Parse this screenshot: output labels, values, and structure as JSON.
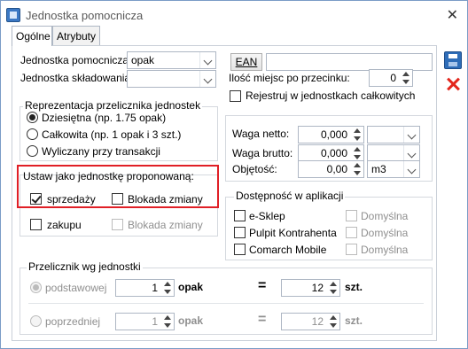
{
  "window": {
    "title": "Jednostka pomocnicza",
    "icon": "app-window-icon"
  },
  "tabs": [
    {
      "label": "Ogólne",
      "active": true
    },
    {
      "label": "Atrybuty",
      "active": false
    }
  ],
  "fields": {
    "aux_unit_label": "Jednostka pomocnicza:",
    "aux_unit_value": "opak",
    "warehouse_unit_label": "Jednostka składowania:",
    "warehouse_unit_value": "",
    "ean_button": "EAN",
    "ean_value": "",
    "decimals_label": "Ilość miejsc po przecinku:",
    "decimals_value": "0",
    "register_whole_label": "Rejestruj w jednostkach całkowitych"
  },
  "conversion_repr": {
    "title": "Reprezentacja przelicznika jednostek",
    "options": [
      {
        "label": "Dziesiętna (np. 1.75 opak)",
        "selected": true
      },
      {
        "label": "Całkowita (np. 1 opak i 3 szt.)",
        "selected": false
      },
      {
        "label": "Wyliczany przy transakcji",
        "selected": false
      }
    ]
  },
  "measures": {
    "net_weight_label": "Waga netto:",
    "net_weight_value": "0,000",
    "net_weight_unit": "",
    "gross_weight_label": "Waga brutto:",
    "gross_weight_value": "0,000",
    "gross_weight_unit": "",
    "volume_label": "Objętość:",
    "volume_value": "0,00",
    "volume_unit": "m3"
  },
  "proposed_unit": {
    "title": "Ustaw jako jednostkę proponowaną:",
    "sales_label": "sprzedaży",
    "sales_checked": true,
    "sales_block_label": "Blokada zmiany",
    "sales_block_checked": false,
    "purchase_label": "zakupu",
    "purchase_checked": false,
    "purchase_block_label": "Blokada zmiany",
    "purchase_block_checked": false
  },
  "availability": {
    "title": "Dostępność w aplikacji",
    "items": [
      {
        "label": "e-Sklep",
        "checked": false,
        "default_label": "Domyślna"
      },
      {
        "label": "Pulpit Kontrahenta",
        "checked": false,
        "default_label": "Domyślna"
      },
      {
        "label": "Comarch Mobile",
        "checked": false,
        "default_label": "Domyślna"
      }
    ]
  },
  "converter": {
    "title": "Przelicznik wg jednostki",
    "base_label": "podstawowej",
    "base_left_value": "1",
    "base_left_unit": "opak",
    "base_equals": "=",
    "base_right_value": "12",
    "base_right_unit": "szt.",
    "prev_label": "poprzedniej",
    "prev_left_value": "1",
    "prev_left_unit": "opak",
    "prev_equals": "=",
    "prev_right_value": "12",
    "prev_right_unit": "szt."
  },
  "colors": {
    "accent": "#2e6db8",
    "highlight": "#e01f26",
    "delete": "#e3261c"
  }
}
